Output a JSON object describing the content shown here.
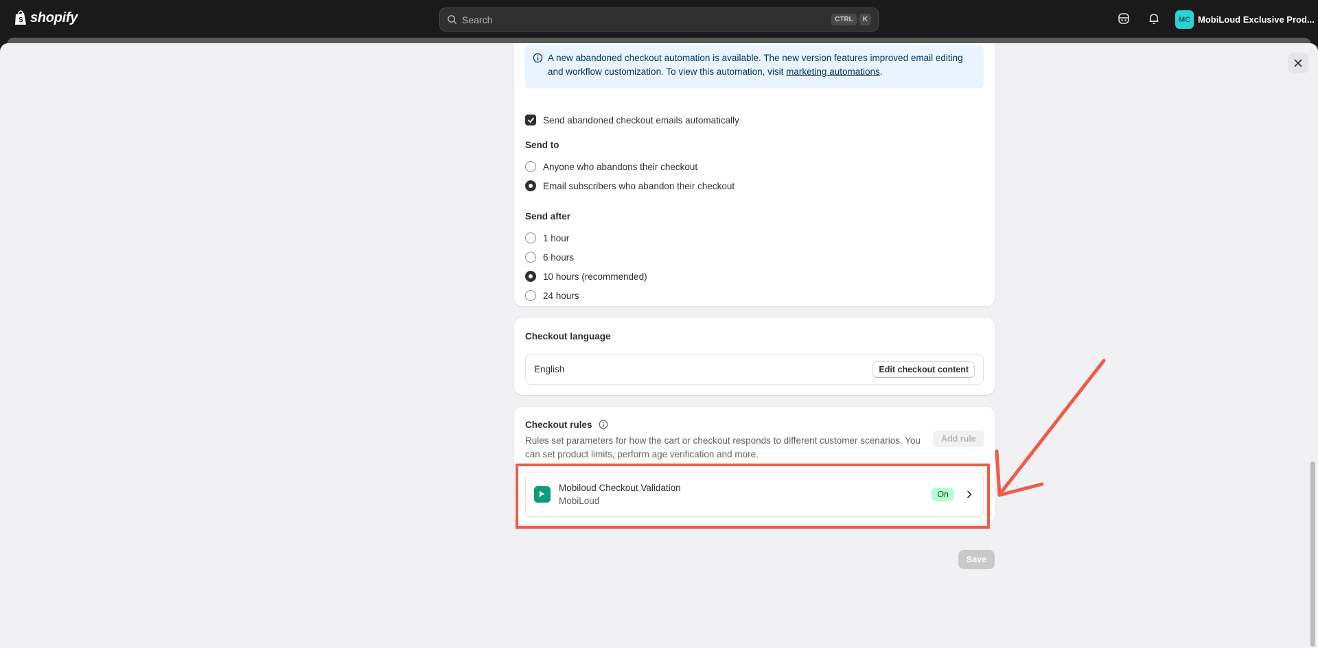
{
  "topbar": {
    "logo_text": "shopify",
    "search_placeholder": "Search",
    "shortcut_keys": [
      "CTRL",
      "K"
    ],
    "avatar_initials": "MC",
    "account_name": "MobiLoud Exclusive Prod..."
  },
  "abandoned_checkout": {
    "banner_text": "A new abandoned checkout automation is available. The new version features improved email editing and workflow customization. To view this automation, visit ",
    "banner_link": "marketing automations",
    "banner_suffix": ".",
    "send_auto_label": "Send abandoned checkout emails automatically",
    "send_to_label": "Send to",
    "send_to_options": [
      {
        "label": "Anyone who abandons their checkout",
        "selected": false
      },
      {
        "label": "Email subscribers who abandon their checkout",
        "selected": true
      }
    ],
    "send_after_label": "Send after",
    "send_after_options": [
      {
        "label": "1 hour",
        "selected": false
      },
      {
        "label": "6 hours",
        "selected": false
      },
      {
        "label": "10 hours (recommended)",
        "selected": true
      },
      {
        "label": "24 hours",
        "selected": false
      }
    ]
  },
  "checkout_language": {
    "title": "Checkout language",
    "language": "English",
    "edit_button": "Edit checkout content"
  },
  "checkout_rules": {
    "title": "Checkout rules",
    "description": "Rules set parameters for how the cart or checkout responds to different customer scenarios. You can set product limits, perform age verification and more.",
    "add_button": "Add rule",
    "rule_name": "Mobiloud Checkout Validation",
    "rule_vendor": "MobiLoud",
    "rule_status": "On"
  },
  "footer": {
    "save_button": "Save"
  },
  "colors": {
    "topbar": "#1a1a1a",
    "annotation": "#ef5b48",
    "badge_on": "#b4fed2",
    "app_icon": "#0f9b7a"
  }
}
